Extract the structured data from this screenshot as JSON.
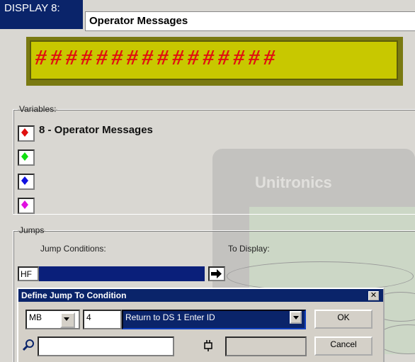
{
  "window": {
    "display_label": "DISPLAY 8:",
    "display_name": "Operator Messages"
  },
  "lcd": {
    "text": "################"
  },
  "variables": {
    "legend": "Variables:",
    "items": [
      {
        "color": "#e01010",
        "label": "8 - Operator Messages"
      },
      {
        "color": "#10e010",
        "label": ""
      },
      {
        "color": "#1010e0",
        "label": ""
      },
      {
        "color": "#e010e0",
        "label": ""
      }
    ]
  },
  "jumps": {
    "legend": "Jumps",
    "conditions_label": "Jump Conditions:",
    "to_display_label": "To Display:",
    "contact_icon_text": "HF"
  },
  "watermark": {
    "brand": "Unitronics"
  },
  "dialog": {
    "title": "Define Jump To Condition",
    "operand_type": "MB",
    "operand_number": "4",
    "operand_description": "Return to DS 1 Enter ID",
    "ok_label": "OK",
    "cancel_label": "Cancel",
    "colors": {
      "selection": "#0a246a"
    }
  }
}
